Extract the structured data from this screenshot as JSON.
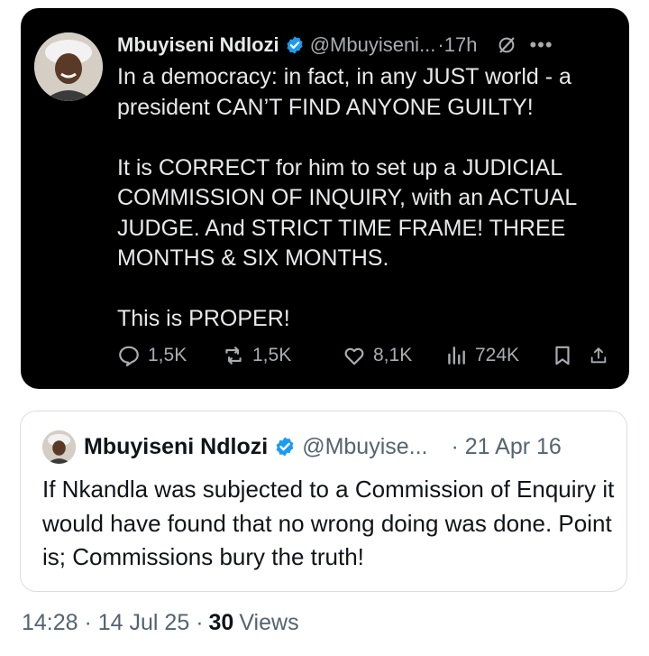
{
  "tweet": {
    "author_name": "Mbuyiseni Ndlozi",
    "handle": "@Mbuyiseni...",
    "separator": "·",
    "time": "17h",
    "paragraphs": [
      "In a democracy: in fact, in any JUST world - a president CAN’T FIND ANYONE GUILTY!",
      "It is CORRECT for him to set up a JUDICIAL COMMISSION OF INQUIRY, with an ACTUAL JUDGE. And STRICT TIME FRAME! THREE MONTHS & SIX MONTHS.",
      "This is PROPER!"
    ],
    "actions": {
      "replies": "1,5K",
      "reposts": "1,5K",
      "likes": "8,1K",
      "views": "724K"
    },
    "icons": [
      "verified-badge-icon",
      "grok-icon",
      "more-icon",
      "reply-icon",
      "repost-icon",
      "like-icon",
      "views-icon",
      "bookmark-icon",
      "share-icon"
    ]
  },
  "quoted_tweet": {
    "author_name": "Mbuyiseni Ndlozi",
    "handle": "@Mbuyise...",
    "date": "· 21 Apr 16",
    "text": "If Nkandla was subjected to a Commission of Enquiry it would have found that no wrong doing was done. Point is; Commissions bury the truth!"
  },
  "meta": {
    "timestamp": "14:28 · 14 Jul 25 ·",
    "views_count": "30",
    "views_label": "Views"
  },
  "colors": {
    "dark_bg": "#000000",
    "dark_text": "#e7e9ea",
    "dark_secondary": "#a9adb1",
    "verified_blue": "#1d9bf0",
    "light_text": "#0f1419",
    "light_secondary": "#536471",
    "border": "#d9dee3"
  }
}
